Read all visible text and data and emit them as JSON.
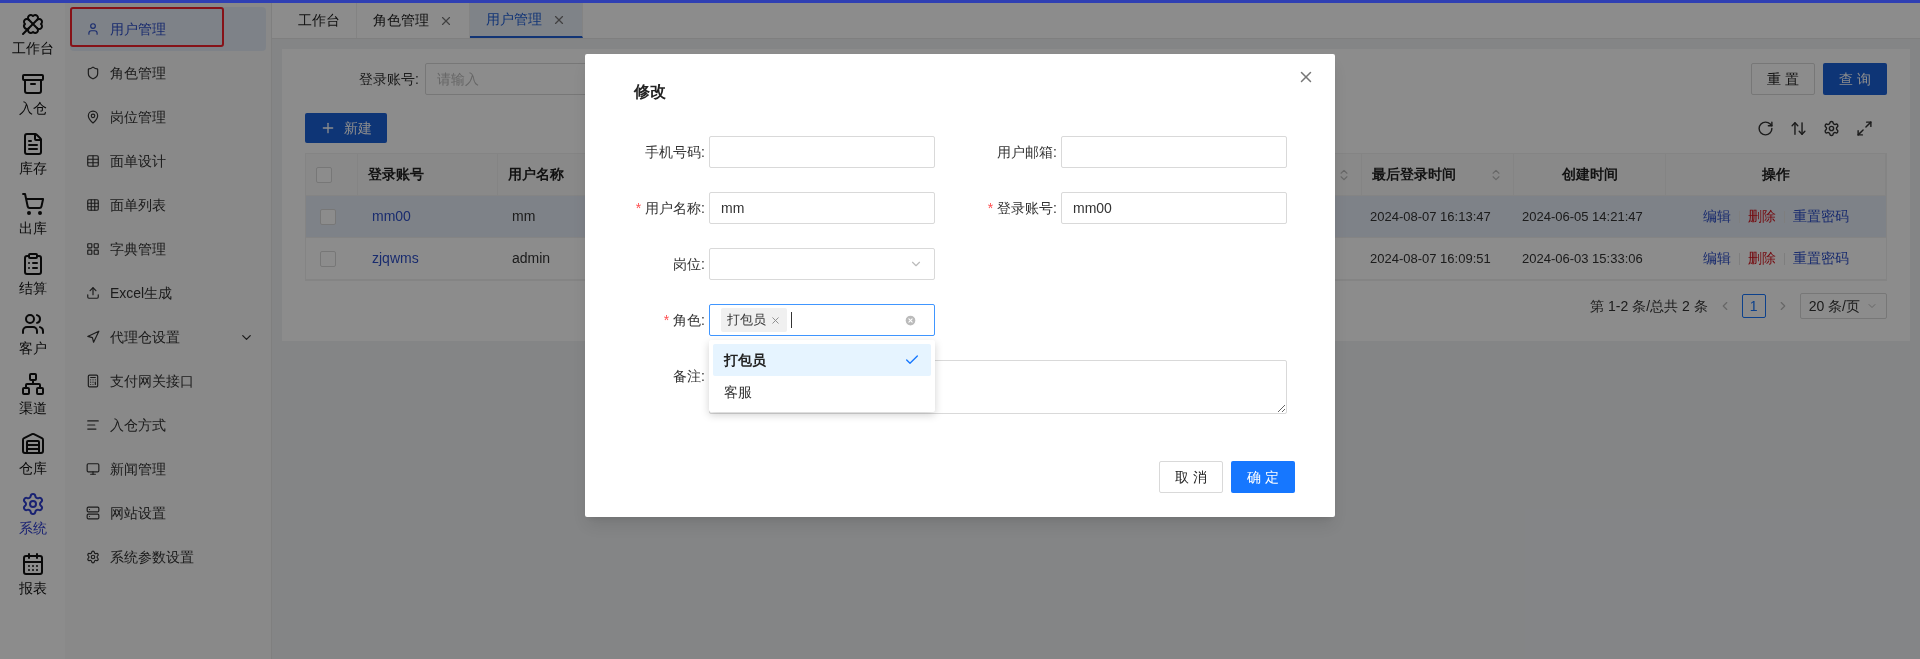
{
  "rail": [
    {
      "label": "工作台",
      "selected": false
    },
    {
      "label": "入仓",
      "selected": false
    },
    {
      "label": "库存",
      "selected": false
    },
    {
      "label": "出库",
      "selected": false
    },
    {
      "label": "结算",
      "selected": false
    },
    {
      "label": "客户",
      "selected": false
    },
    {
      "label": "渠道",
      "selected": false
    },
    {
      "label": "仓库",
      "selected": false
    },
    {
      "label": "系统",
      "selected": true
    },
    {
      "label": "报表",
      "selected": false
    }
  ],
  "sidebar": {
    "items": [
      {
        "label": "用户管理",
        "selected": true,
        "kind": "link"
      },
      {
        "label": "角色管理",
        "selected": false,
        "kind": "link"
      },
      {
        "label": "岗位管理",
        "selected": false,
        "kind": "link"
      },
      {
        "label": "面单设计",
        "selected": false,
        "kind": "link"
      },
      {
        "label": "面单列表",
        "selected": false,
        "kind": "link"
      },
      {
        "label": "字典管理",
        "selected": false,
        "kind": "link"
      },
      {
        "label": "Excel生成",
        "selected": false,
        "kind": "link"
      },
      {
        "label": "代理仓设置",
        "selected": false,
        "kind": "submenu"
      },
      {
        "label": "支付网关接口",
        "selected": false,
        "kind": "link"
      },
      {
        "label": "入仓方式",
        "selected": false,
        "kind": "link"
      },
      {
        "label": "新闻管理",
        "selected": false,
        "kind": "link"
      },
      {
        "label": "网站设置",
        "selected": false,
        "kind": "link"
      },
      {
        "label": "系统参数设置",
        "selected": false,
        "kind": "link"
      }
    ]
  },
  "tabs": [
    {
      "label": "工作台",
      "selected": false,
      "closable": false
    },
    {
      "label": "角色管理",
      "selected": false,
      "closable": true
    },
    {
      "label": "用户管理",
      "selected": true,
      "closable": true
    }
  ],
  "search": {
    "label": "登录账号:",
    "placeholder": "请输入",
    "buttons": [
      {
        "label": "重 置",
        "kind": "default"
      },
      {
        "label": "查 询",
        "kind": "primary"
      }
    ]
  },
  "new_button": "新建",
  "table": {
    "columns": [
      {
        "kind": "checkbox",
        "checked": false
      },
      {
        "label": "登录账号"
      },
      {
        "label": "用户名称"
      },
      {
        "sortable": true
      },
      {
        "label": "最后登录时间",
        "sortable": true
      },
      {
        "label": "创建时间"
      },
      {
        "label": "操作"
      }
    ],
    "rows": [
      {
        "checked": false,
        "selected": true,
        "login": "mm00",
        "name": "mm",
        "last_login": "2024-08-07 16:13:47",
        "created": "2024-06-05 14:21:47",
        "actions": [
          {
            "label": "编辑",
            "kind": "link"
          },
          {
            "label": "删除",
            "kind": "danger"
          },
          {
            "label": "重置密码",
            "kind": "link"
          }
        ]
      },
      {
        "checked": false,
        "selected": false,
        "login": "zjqwms",
        "name": "admin",
        "last_login": "2024-08-07 16:09:51",
        "created": "2024-06-03 15:33:06",
        "actions": [
          {
            "label": "编辑",
            "kind": "link"
          },
          {
            "label": "删除",
            "kind": "danger"
          },
          {
            "label": "重置密码",
            "kind": "link"
          }
        ]
      }
    ]
  },
  "pagination": {
    "summary": "第 1-2 条/总共 2 条",
    "pages": [
      {
        "label": "1",
        "selected": true
      }
    ],
    "page_size": "20 条/页"
  },
  "dialog": {
    "title": "修改",
    "rows": [
      [
        {
          "label": "手机号码:",
          "kind": "text"
        },
        {
          "label": "用户邮箱:",
          "kind": "text"
        }
      ],
      [
        {
          "label": "用户名称:",
          "required_mark": "*",
          "kind": "text",
          "value": "mm"
        },
        {
          "label": "登录账号:",
          "required_mark": "*",
          "kind": "text",
          "value": "mm00"
        }
      ],
      [
        {
          "label": "岗位:",
          "kind": "select"
        }
      ],
      [
        {
          "label": "角色:",
          "required_mark": "*",
          "kind": "tags",
          "tags": [
            "打包员"
          ],
          "options": [
            {
              "label": "打包员",
              "selected": true
            },
            {
              "label": "客服",
              "selected": false
            }
          ]
        }
      ],
      [
        {
          "label": "备注:",
          "kind": "textarea"
        }
      ]
    ],
    "buttons": [
      {
        "label": "取 消",
        "kind": "default"
      },
      {
        "label": "确 定",
        "kind": "primary"
      }
    ]
  }
}
